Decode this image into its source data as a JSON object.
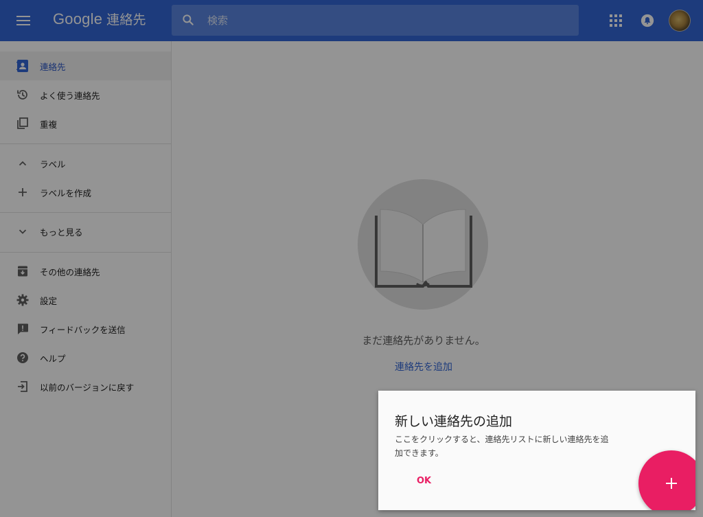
{
  "header": {
    "logo_google": "Google",
    "logo_product": "連絡先",
    "search_placeholder": "検索"
  },
  "sidebar": {
    "items": [
      {
        "label": "連絡先",
        "icon": "contacts-icon",
        "active": true
      },
      {
        "label": "よく使う連絡先",
        "icon": "history-icon"
      },
      {
        "label": "重複",
        "icon": "copy-icon"
      },
      {
        "label": "ラベル",
        "icon": "chevron-up-icon"
      },
      {
        "label": "ラベルを作成",
        "icon": "plus-icon"
      },
      {
        "label": "もっと見る",
        "icon": "chevron-down-icon"
      },
      {
        "label": "その他の連絡先",
        "icon": "archive-icon"
      },
      {
        "label": "設定",
        "icon": "gear-icon"
      },
      {
        "label": "フィードバックを送信",
        "icon": "feedback-icon"
      },
      {
        "label": "ヘルプ",
        "icon": "help-icon"
      },
      {
        "label": "以前のバージョンに戻す",
        "icon": "exit-icon"
      }
    ]
  },
  "main": {
    "empty_text": "まだ連絡先がありません。",
    "add_link": "連絡先を追加"
  },
  "popup": {
    "title": "新しい連絡先の追加",
    "body": "ここをクリックすると、連絡先リストに新しい連絡先を追加できます。",
    "ok_label": "OK"
  },
  "colors": {
    "header": "#3367d6",
    "accent": "#e91e63",
    "link": "#3367d6"
  }
}
